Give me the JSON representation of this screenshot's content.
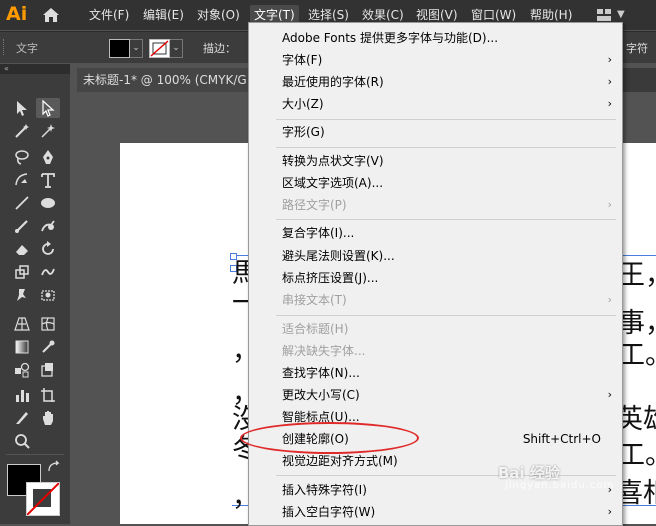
{
  "app": {
    "logo": "Ai"
  },
  "menubar": {
    "items": [
      "文件(F)",
      "编辑(E)",
      "对象(O)",
      "文字(T)",
      "选择(S)",
      "效果(C)",
      "视图(V)",
      "窗口(W)",
      "帮助(H)"
    ],
    "active_index": 3
  },
  "control_bar": {
    "type_label": "文字",
    "stroke_label": "描边：",
    "right_label": "字符"
  },
  "document_tab": {
    "title": "未标题-1* @ 100% (CMYK/G"
  },
  "artboard_text": {
    "left_chars": [
      "馬",
      "一",
      "，",
      "，",
      "沒",
      "冬",
      "，"
    ],
    "right_chars": [
      "王，",
      "事，",
      "工。",
      "英雄",
      "工。",
      "喜相"
    ]
  },
  "type_menu": {
    "items": [
      {
        "label": "Adobe Fonts 提供更多字体与功能(D)...",
        "enabled": true,
        "submenu": false
      },
      {
        "label": "字体(F)",
        "enabled": true,
        "submenu": true
      },
      {
        "label": "最近使用的字体(R)",
        "enabled": true,
        "submenu": true
      },
      {
        "label": "大小(Z)",
        "enabled": true,
        "submenu": true
      },
      {
        "sep": true
      },
      {
        "label": "字形(G)",
        "enabled": true,
        "submenu": false
      },
      {
        "sep": true
      },
      {
        "label": "转换为点状文字(V)",
        "enabled": true,
        "submenu": false
      },
      {
        "label": "区域文字选项(A)...",
        "enabled": true,
        "submenu": false
      },
      {
        "label": "路径文字(P)",
        "enabled": false,
        "submenu": true
      },
      {
        "sep": true
      },
      {
        "label": "复合字体(I)...",
        "enabled": true,
        "submenu": false
      },
      {
        "label": "避头尾法则设置(K)...",
        "enabled": true,
        "submenu": false
      },
      {
        "label": "标点挤压设置(J)...",
        "enabled": true,
        "submenu": false
      },
      {
        "label": "串接文本(T)",
        "enabled": false,
        "submenu": true
      },
      {
        "sep": true
      },
      {
        "label": "适合标题(H)",
        "enabled": false,
        "submenu": false
      },
      {
        "label": "解决缺失字体...",
        "enabled": false,
        "submenu": false
      },
      {
        "label": "查找字体(N)...",
        "enabled": true,
        "submenu": false
      },
      {
        "label": "更改大小写(C)",
        "enabled": true,
        "submenu": true
      },
      {
        "label": "智能标点(U)...",
        "enabled": true,
        "submenu": false
      },
      {
        "label": "创建轮廓(O)",
        "enabled": true,
        "submenu": false,
        "shortcut": "Shift+Ctrl+O",
        "highlight": true
      },
      {
        "label": "视觉边距对齐方式(M)",
        "enabled": true,
        "submenu": false
      },
      {
        "sep": true
      },
      {
        "label": "插入特殊字符(I)",
        "enabled": true,
        "submenu": true
      },
      {
        "label": "插入空白字符(W)",
        "enabled": true,
        "submenu": true
      }
    ]
  },
  "watermark": {
    "text": "Bai 经验",
    "sub": "jingyan.baidu.com"
  },
  "colors": {
    "accent_orange": "#ff9a00",
    "highlight_red": "#e02a2a",
    "selection_blue": "#4a7de0"
  }
}
